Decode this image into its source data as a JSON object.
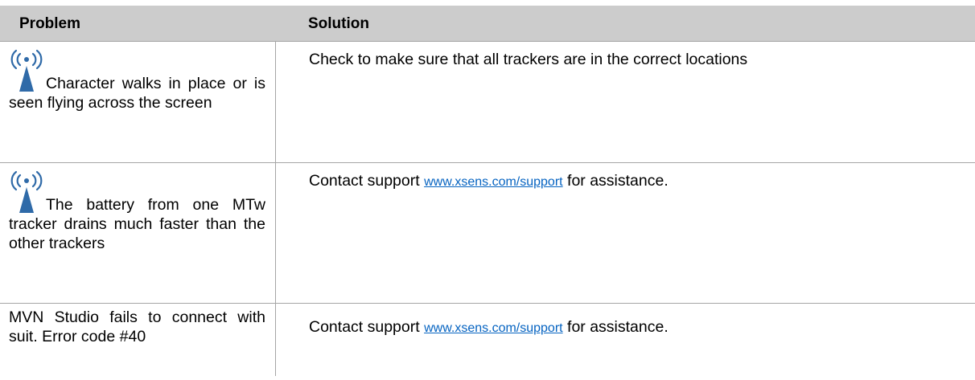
{
  "table": {
    "header": {
      "problem": "Problem",
      "solution": "Solution"
    },
    "rows": [
      {
        "icon": "wireless-signal-icon",
        "problem": "Character walks in place or is seen flying across the screen",
        "solution": "Check to make sure that all trackers are in the correct locations"
      },
      {
        "icon": "wireless-signal-icon",
        "problem": "The battery from one MTw tracker drains much faster than the other trackers",
        "solution_before": "Contact support ",
        "solution_link": "www.xsens.com/support",
        "solution_after": " for assistance."
      },
      {
        "problem": "MVN Studio fails to connect with suit. Error code #40",
        "solution_before": "Contact support ",
        "solution_link": "www.xsens.com/support",
        "solution_after": " for assistance."
      }
    ]
  },
  "colors": {
    "header_bg": "#cccccc",
    "border": "#a6a6a6",
    "icon_blue": "#2f6aa8",
    "link": "#0563c1"
  }
}
